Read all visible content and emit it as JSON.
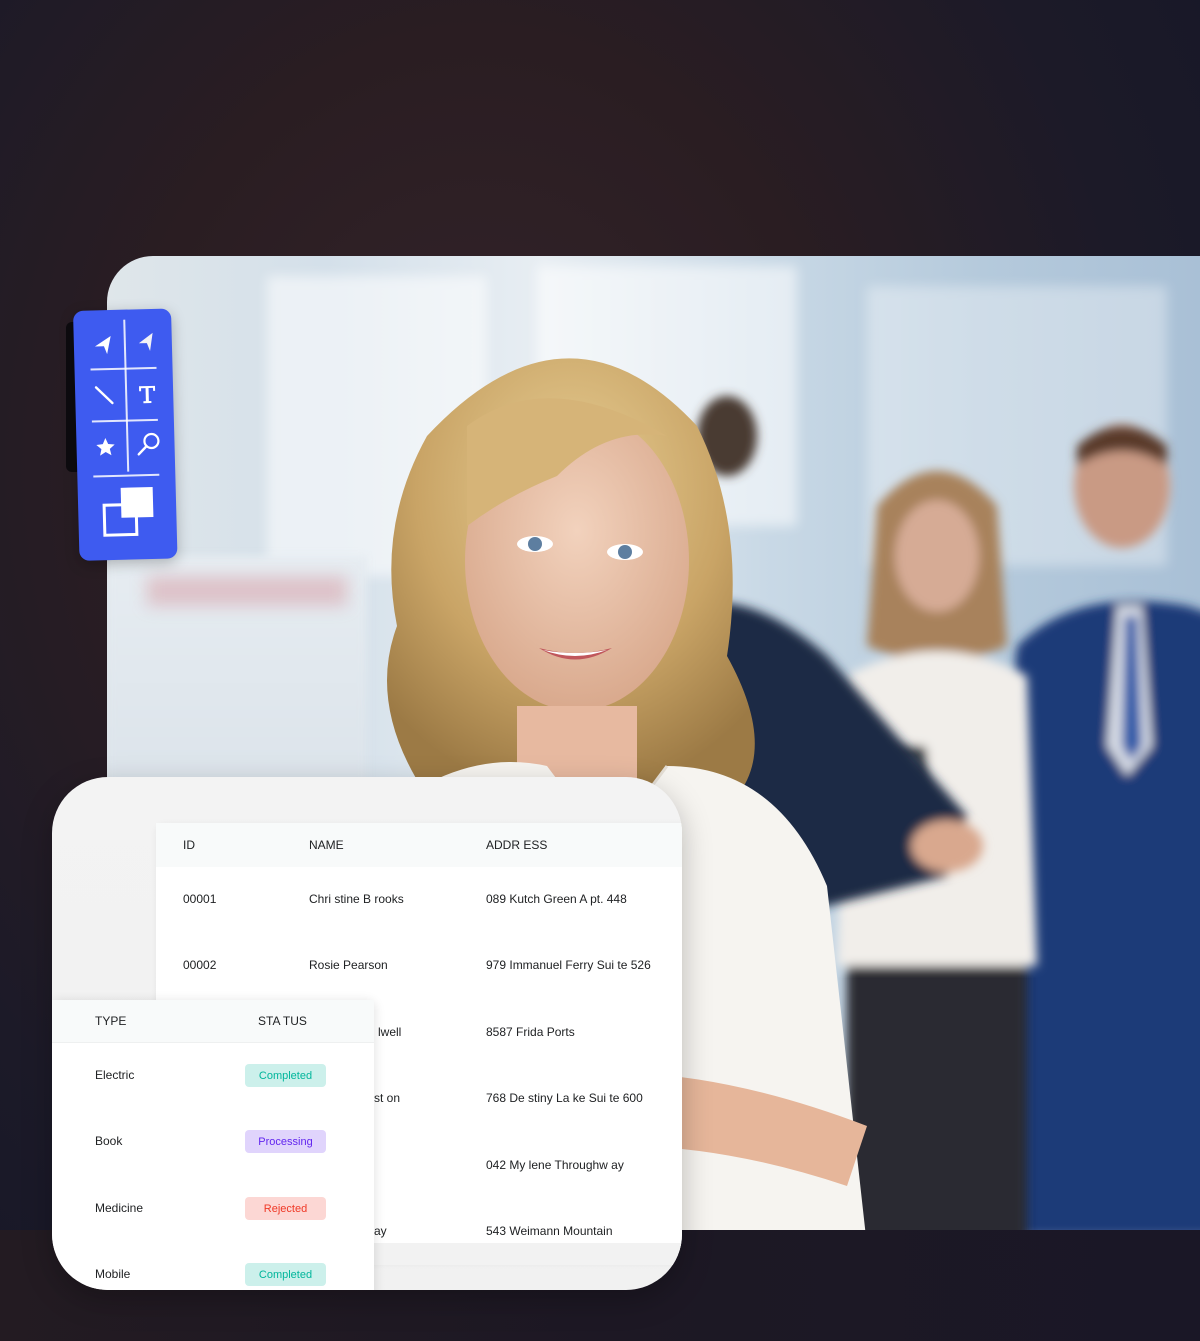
{
  "toolbar": {
    "tools": [
      {
        "name": "select-arrow",
        "label": "Select"
      },
      {
        "name": "direct-select-arrow",
        "label": "Direct Select"
      },
      {
        "name": "line",
        "label": "Line"
      },
      {
        "name": "text",
        "label": "T"
      },
      {
        "name": "star",
        "label": "Star"
      },
      {
        "name": "zoom",
        "label": "Zoom"
      },
      {
        "name": "fill-stroke",
        "label": "Fill & Stroke"
      }
    ],
    "accent_color": "#3e5bf0"
  },
  "main_table": {
    "columns": [
      "ID",
      "NAME",
      "ADDR ESS"
    ],
    "rows": [
      {
        "id": "00001",
        "name": "Chri stine B rooks",
        "address": "089  Kutch Green A pt. 448"
      },
      {
        "id": "00002",
        "name": "Rosie  Pearson",
        "address": "979 Immanuel    Ferry Sui te 526"
      },
      {
        "id": "",
        "name": "lwell",
        "address": "8587  Frida Ports"
      },
      {
        "id": "",
        "name": "st on",
        "address": "768 De  stiny La ke Sui te 600"
      },
      {
        "id": "",
        "name": "",
        "address": "042 My  lene Throughw ay"
      },
      {
        "id": "",
        "name": "ay",
        "address": "543  Weimann Mountain"
      }
    ]
  },
  "side_table": {
    "columns": [
      "TYPE",
      "STA TUS"
    ],
    "rows": [
      {
        "type": "Electric",
        "status": "Completed",
        "status_kind": "completed"
      },
      {
        "type": "Book",
        "status": "Processing",
        "status_kind": "processing"
      },
      {
        "type": "Medicine",
        "status": "Rejected",
        "status_kind": "rejected"
      },
      {
        "type": "Mobile",
        "status": "Completed",
        "status_kind": "completed"
      }
    ],
    "status_colors": {
      "completed": {
        "bg": "#ccf0eb",
        "fg": "#00b69b"
      },
      "processing": {
        "bg": "#e0d4fc",
        "fg": "#6226ef"
      },
      "rejected": {
        "bg": "#fcd7d4",
        "fg": "#ef3826"
      }
    }
  }
}
